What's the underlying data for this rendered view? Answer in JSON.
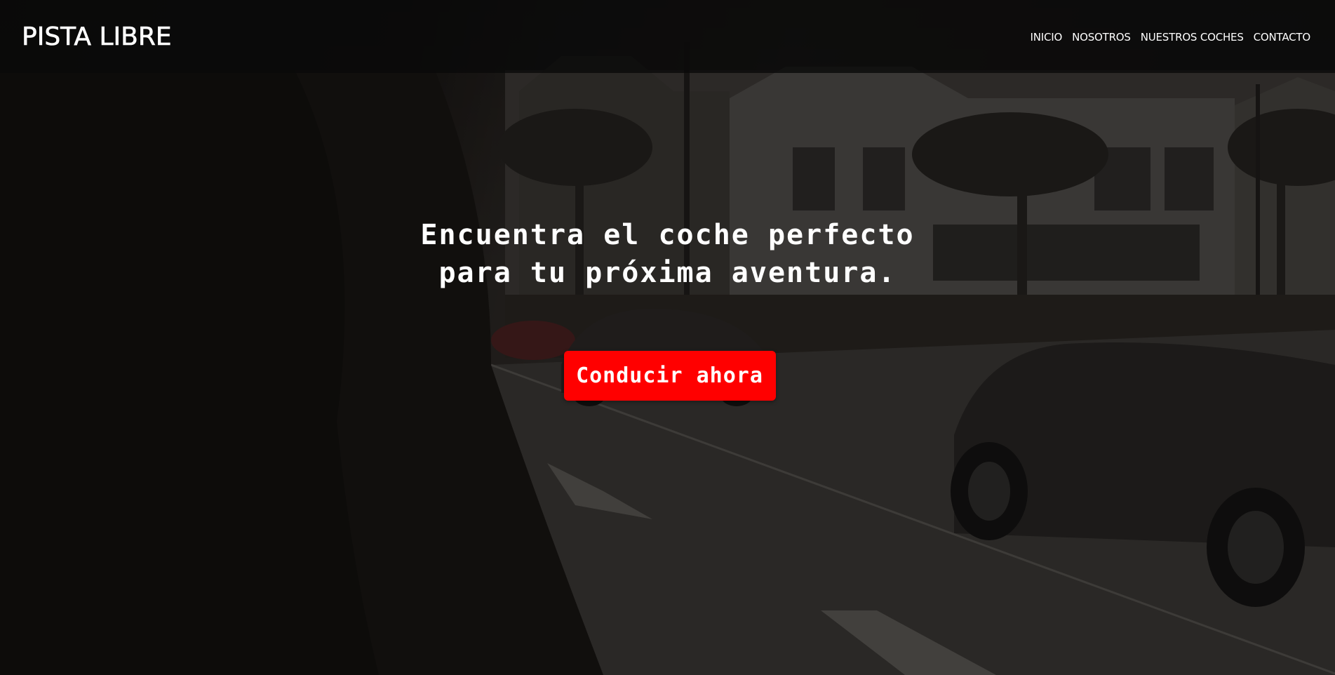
{
  "brand": {
    "name": "PISTA LIBRE"
  },
  "nav": {
    "items": [
      {
        "label": "INICIO"
      },
      {
        "label": "NOSOTROS"
      },
      {
        "label": "NUESTROS COCHES"
      },
      {
        "label": "CONTACTO"
      }
    ]
  },
  "hero": {
    "title_line_1": "Encuentra el coche perfecto",
    "title_line_2": "para tu próxima aventura.",
    "cta_label": "Conducir ahora",
    "background_image": "dark street scene with sports cars and palm trees"
  },
  "colors": {
    "cta_background": "#ff0000",
    "navbar_background": "#0a0a0a",
    "text": "#ffffff"
  }
}
